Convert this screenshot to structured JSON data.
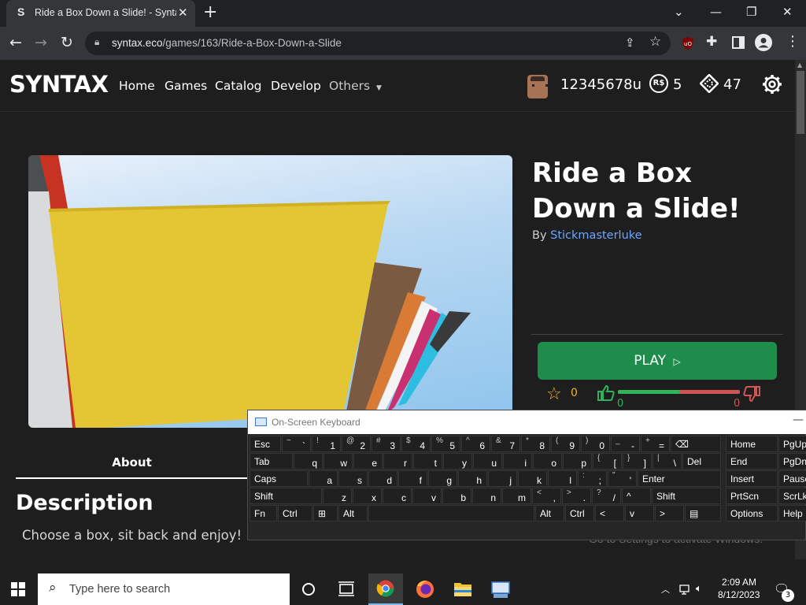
{
  "browser": {
    "tab_title": "Ride a Box Down a Slide! - Syntax",
    "tab_favicon": "S",
    "url_host": "syntax.eco",
    "url_path": "/games/163/Ride-a-Box-Down-a-Slide",
    "icons": [
      "back-icon",
      "forward-icon",
      "reload-icon",
      "lock-icon",
      "share-icon",
      "star-icon",
      "ublock-icon",
      "extensions-icon",
      "sidepanel-icon",
      "profile-icon",
      "menu-icon"
    ]
  },
  "site": {
    "logo": "SYNTAX",
    "nav": {
      "home": "Home",
      "games": "Games",
      "catalog": "Catalog",
      "develop": "Develop",
      "others": "Others"
    },
    "user": {
      "username": "12345678u",
      "robux_icon": "R$",
      "robux": "5",
      "tix": "47"
    }
  },
  "game": {
    "title": "Ride a Box Down a Slide!",
    "by_label": "By",
    "creator": "Stickmasterluke",
    "play_label": "PLAY",
    "favorites": "0",
    "upvotes": "0",
    "downvotes": "0",
    "vote_ratio_percent": 50,
    "about_tab": "About",
    "description_heading": "Description",
    "description_text": "Choose a box, sit back and enjoy!"
  },
  "osk": {
    "title": "On-Screen Keyboard"
  },
  "windows_watermark": "Go to Settings to activate Windows.",
  "taskbar": {
    "search_placeholder": "Type here to search",
    "time": "2:09 AM",
    "date": "8/12/2023",
    "notifications": "3"
  },
  "colors": {
    "play_button": "#1e8c4a",
    "creator_link": "#6aa7ff",
    "favorite": "#f0b429",
    "upvote": "#2fb45a",
    "downvote": "#d05555"
  }
}
